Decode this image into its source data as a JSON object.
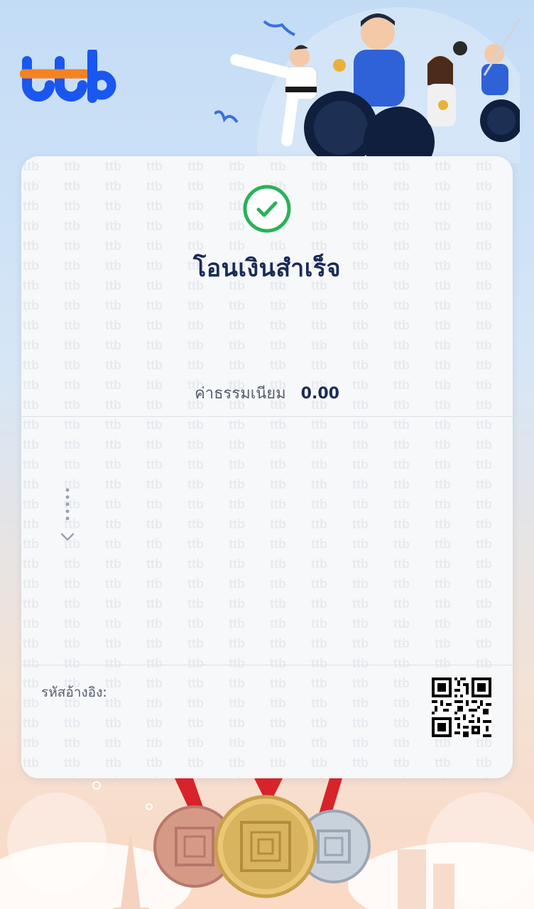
{
  "brand": {
    "name": "ttb",
    "primary_color": "#1a56f0",
    "accent_color": "#f58220"
  },
  "receipt": {
    "status_icon": "check-circle-icon",
    "status_color": "#2ab25a",
    "title": "โอนเงินสำเร็จ",
    "fee_label": "ค่าธรรมเนียม",
    "fee_value": "0.00",
    "expand_icon": "chevron-down-icon",
    "reference_label": "รหัสอ้างอิง:",
    "qr_icon": "qr-code-icon"
  }
}
